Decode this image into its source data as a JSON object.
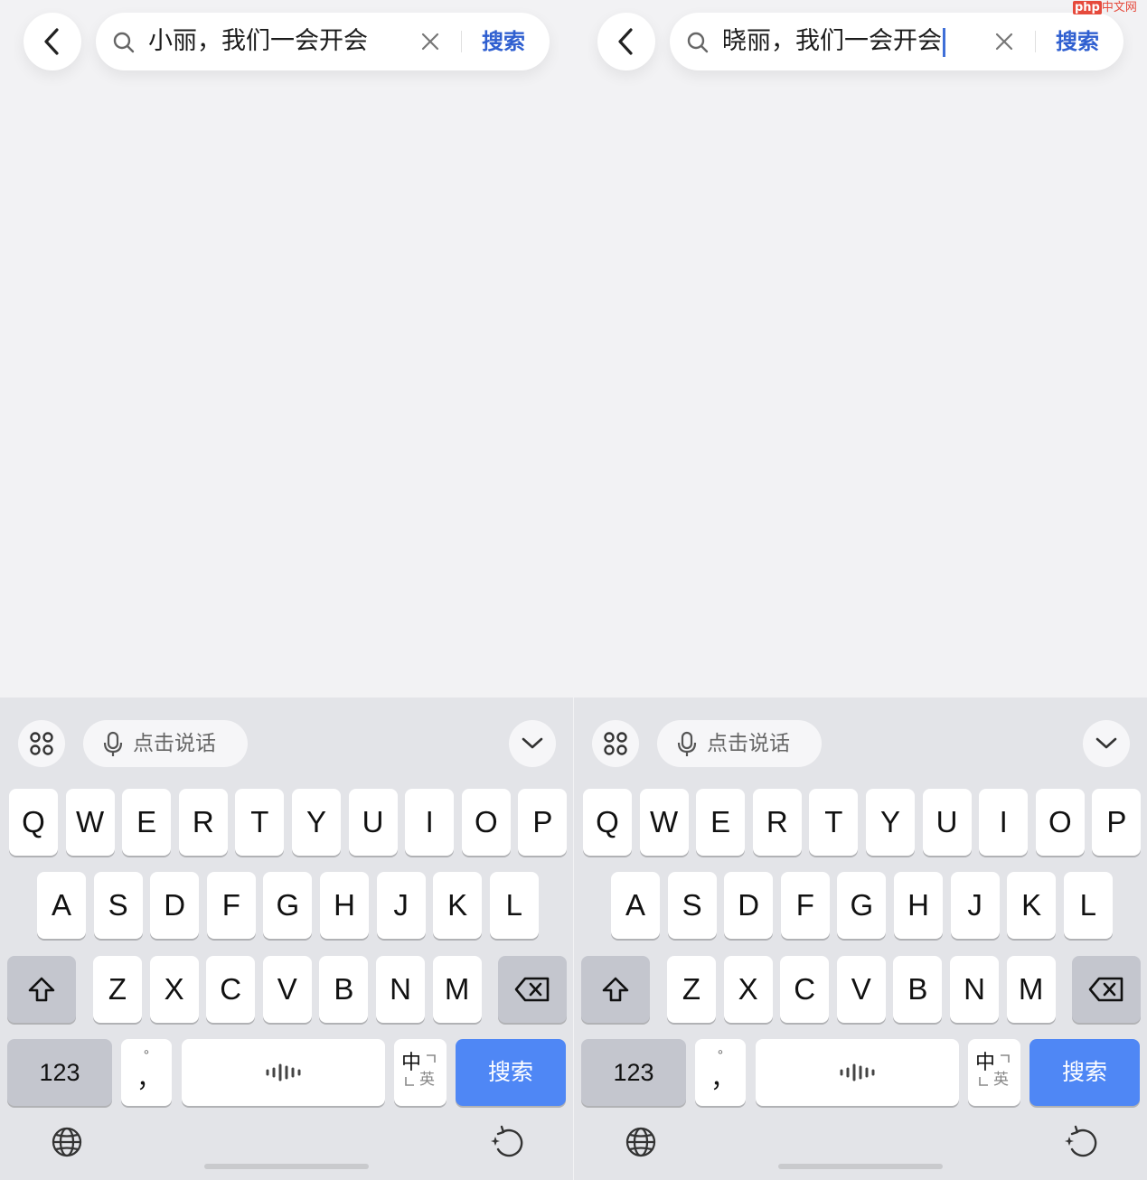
{
  "panels": [
    {
      "query": "小丽，我们一会开会",
      "search_button": "搜索",
      "voice_label": "点击说话",
      "letters_row1": [
        "Q",
        "W",
        "E",
        "R",
        "T",
        "Y",
        "U",
        "I",
        "O",
        "P"
      ],
      "letters_row2": [
        "A",
        "S",
        "D",
        "F",
        "G",
        "H",
        "J",
        "K",
        "L"
      ],
      "letters_row3": [
        "Z",
        "X",
        "C",
        "V",
        "B",
        "N",
        "M"
      ],
      "num_key": "123",
      "punct_top": "°",
      "punct_bottom": "，",
      "lang_top": "中",
      "lang_bottom": "英",
      "enter_key": "搜索"
    },
    {
      "query": "晓丽，我们一会开会",
      "search_button": "搜索",
      "voice_label": "点击说话",
      "letters_row1": [
        "Q",
        "W",
        "E",
        "R",
        "T",
        "Y",
        "U",
        "I",
        "O",
        "P"
      ],
      "letters_row2": [
        "A",
        "S",
        "D",
        "F",
        "G",
        "H",
        "J",
        "K",
        "L"
      ],
      "letters_row3": [
        "Z",
        "X",
        "C",
        "V",
        "B",
        "N",
        "M"
      ],
      "num_key": "123",
      "punct_top": "°",
      "punct_bottom": "，",
      "lang_top": "中",
      "lang_bottom": "英",
      "enter_key": "搜索"
    }
  ],
  "watermark": {
    "brand": "php",
    "site": "中文网"
  },
  "colors": {
    "accent": "#4f87f5",
    "link": "#2f5fd0",
    "caret": "#3f6fd8"
  },
  "icons": [
    "back-chevron-icon",
    "search-icon",
    "clear-icon",
    "apps-grid-icon",
    "microphone-icon",
    "collapse-chevron-icon",
    "shift-arrow-icon",
    "backspace-icon",
    "space-waveform-icon",
    "globe-icon",
    "refresh-sparkle-icon"
  ]
}
